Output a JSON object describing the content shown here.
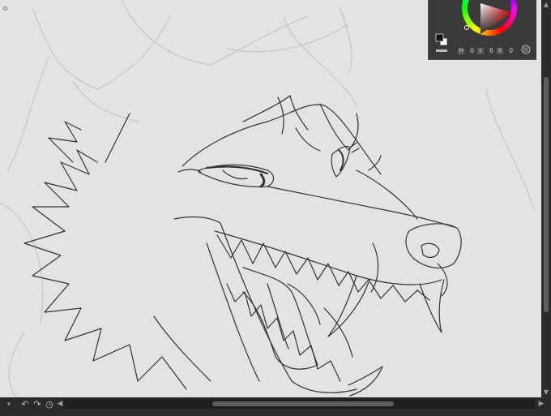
{
  "color_panel": {
    "h_label": "H",
    "h_value": "0",
    "l_label": "L",
    "l_value": "6",
    "s_label": "S",
    "s_value": "0",
    "hue_ring_colors": [
      "#ff0000",
      "#ffff00",
      "#00ff00",
      "#00ffff",
      "#0000ff",
      "#ff00ff",
      "#ff0000"
    ],
    "main_color": "#111111",
    "sub_color": "#ffffff",
    "panel_icon": "grid-icon"
  },
  "canvas": {
    "background": "#e3e3e3",
    "line_color": "#3a3a3a",
    "sketch_color": "#c9c9c9"
  },
  "bottom_bar": {
    "undo_icon": "undo-icon",
    "redo_icon": "redo-icon",
    "history_icon": "history-icon",
    "scroll_left_icon": "chevron-left-icon",
    "scroll_right_icon": "chevron-right-icon"
  },
  "vscroll": {
    "up_icon": "chevron-up-icon",
    "down_icon": "chevron-down-icon"
  }
}
